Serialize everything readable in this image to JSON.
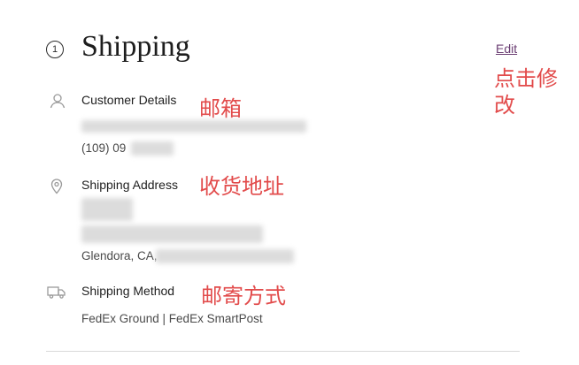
{
  "header": {
    "step_number": "1",
    "title": "Shipping",
    "edit_label": "Edit"
  },
  "sections": {
    "customer": {
      "label": "Customer Details",
      "phone": "(109) 09"
    },
    "address": {
      "label": "Shipping Address",
      "city_line": "Glendora, CA,"
    },
    "method": {
      "label": "Shipping Method",
      "value": "FedEx Ground | FedEx SmartPost"
    }
  },
  "annotations": {
    "edit": "点击修改",
    "email": "邮箱",
    "address": "收货地址",
    "method": "邮寄方式"
  },
  "colors": {
    "annotation": "#e24b4b",
    "edit_link": "#6b3e73",
    "icon": "#9a9a9a"
  },
  "icons": {
    "customer": "person-icon",
    "address": "location-pin-icon",
    "method": "truck-icon"
  }
}
